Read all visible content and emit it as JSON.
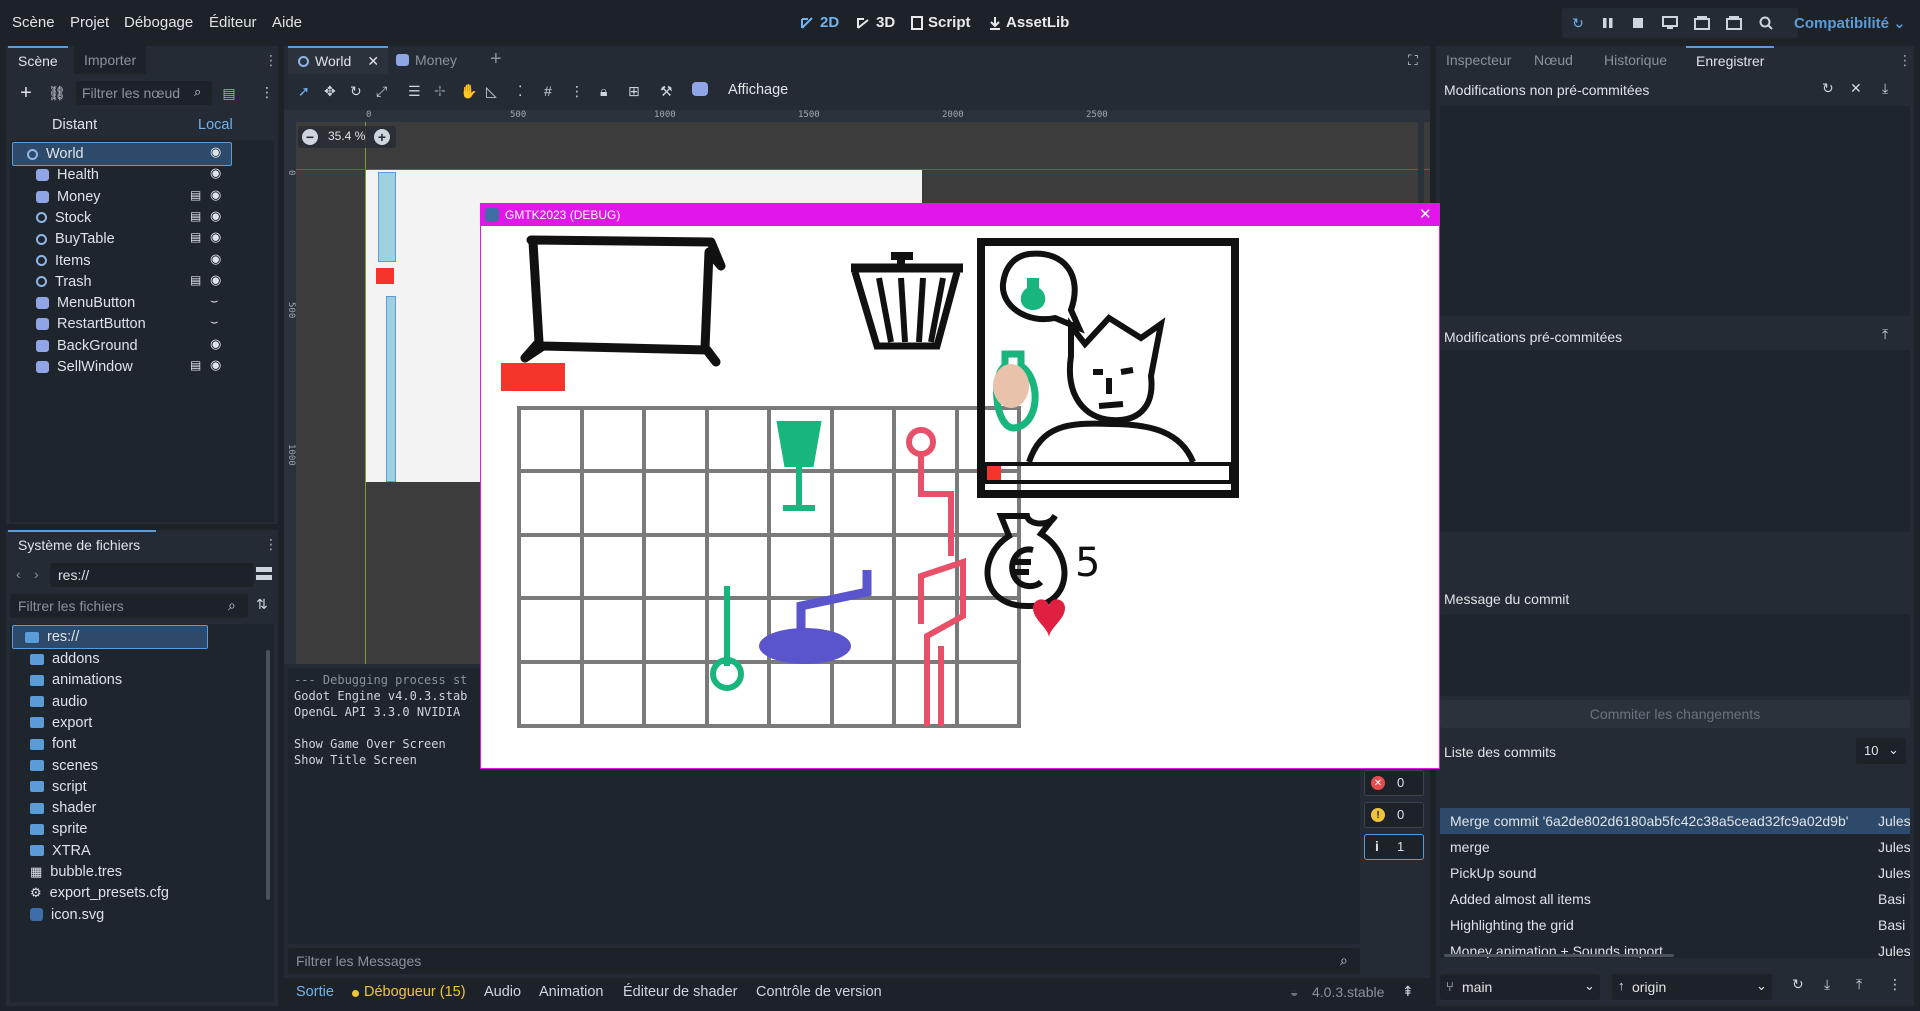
{
  "menu": [
    "Scène",
    "Projet",
    "Débogage",
    "Éditeur",
    "Aide"
  ],
  "modes": {
    "two_d": "2D",
    "three_d": "3D",
    "script": "Script",
    "assetlib": "AssetLib"
  },
  "renderer": "Compatibilité",
  "scene_dock": {
    "tabs": [
      "Scène",
      "Importer"
    ],
    "filter_placeholder": "Filtrer les nœud",
    "remote": "Distant",
    "local": "Local",
    "nodes": [
      {
        "name": "World",
        "icon": "node2d-icon",
        "script": false,
        "visible": true
      },
      {
        "name": "Health",
        "icon": "control-icon",
        "script": false,
        "visible": true
      },
      {
        "name": "Money",
        "icon": "control-icon",
        "script": true,
        "visible": true
      },
      {
        "name": "Stock",
        "icon": "node2d-icon",
        "script": true,
        "visible": true
      },
      {
        "name": "BuyTable",
        "icon": "node2d-icon",
        "script": true,
        "visible": true
      },
      {
        "name": "Items",
        "icon": "node2d-icon",
        "script": false,
        "visible": true
      },
      {
        "name": "Trash",
        "icon": "node2d-icon",
        "script": true,
        "visible": true
      },
      {
        "name": "MenuButton",
        "icon": "control-icon",
        "script": false,
        "visible": false
      },
      {
        "name": "RestartButton",
        "icon": "control-icon",
        "script": false,
        "visible": false
      },
      {
        "name": "BackGround",
        "icon": "control-icon",
        "script": false,
        "visible": true
      },
      {
        "name": "SellWindow",
        "icon": "control-icon",
        "script": true,
        "visible": true
      }
    ]
  },
  "filesystem": {
    "title": "Système de fichiers",
    "path": "res://",
    "filter_placeholder": "Filtrer les fichiers",
    "root": "res://",
    "items": [
      {
        "name": "addons",
        "type": "folder"
      },
      {
        "name": "animations",
        "type": "folder"
      },
      {
        "name": "audio",
        "type": "folder"
      },
      {
        "name": "export",
        "type": "folder"
      },
      {
        "name": "font",
        "type": "folder"
      },
      {
        "name": "scenes",
        "type": "folder"
      },
      {
        "name": "script",
        "type": "folder"
      },
      {
        "name": "shader",
        "type": "folder"
      },
      {
        "name": "sprite",
        "type": "folder"
      },
      {
        "name": "XTRA",
        "type": "folder"
      },
      {
        "name": "bubble.tres",
        "type": "resource"
      },
      {
        "name": "export_presets.cfg",
        "type": "config"
      },
      {
        "name": "icon.svg",
        "type": "image"
      }
    ]
  },
  "editor_tabs": [
    "World",
    "Money"
  ],
  "toolbar": {
    "view_menu": "Affichage",
    "zoom": "35.4 %"
  },
  "ruler": {
    "h": [
      "0",
      "500",
      "1000",
      "1500",
      "2000",
      "2500"
    ],
    "v": [
      "0",
      "500",
      "1000"
    ]
  },
  "game_window": {
    "title": "GMTK2023 (DEBUG)",
    "money": "5"
  },
  "output": {
    "lines": [
      "--- Debugging process st",
      "Godot Engine v4.0.3.stab",
      "OpenGL API 3.3.0 NVIDIA ",
      "",
      "Show Game Over Screen",
      "Show Title Screen"
    ],
    "filter_placeholder": "Filtrer les Messages",
    "errors": "0",
    "warnings": "0",
    "messages": "1"
  },
  "bottom_tabs": [
    "Sortie",
    "Débogueur (15)",
    "Audio",
    "Animation",
    "Éditeur de shader",
    "Contrôle de version"
  ],
  "version": "4.0.3.stable",
  "right_dock": {
    "tabs": [
      "Inspecteur",
      "Nœud",
      "Historique",
      "Enregistrer"
    ],
    "unstaged": "Modifications non pré-commitées",
    "staged": "Modifications pré-commitées",
    "commit_message": "Message du commit",
    "commit_button": "Commiter les changements",
    "commit_list": "Liste des commits",
    "commit_count": "10",
    "commits": [
      {
        "message": "Merge commit '6a2de802d6180ab5fc42c38a5cead32fc9a02d9b'",
        "author": "Jules"
      },
      {
        "message": "merge",
        "author": "Jules"
      },
      {
        "message": "PickUp sound",
        "author": "Jules"
      },
      {
        "message": "Added almost all items",
        "author": "Basi"
      },
      {
        "message": "Highlighting the grid",
        "author": "Basi"
      },
      {
        "message": "Money animation + Sounds import",
        "author": "Jules"
      }
    ],
    "branch": "main",
    "remote": "origin"
  },
  "colors": {
    "accent": "#5b9bd8",
    "game_titlebar": "#e017e8",
    "health_red": "#f5352c"
  }
}
